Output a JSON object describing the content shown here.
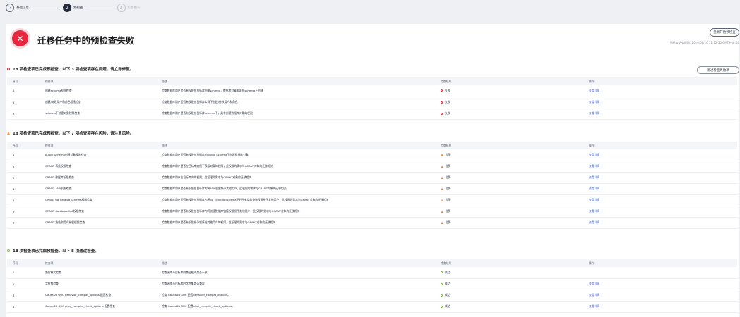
{
  "steps": [
    {
      "label": "基础信息",
      "state": "done"
    },
    {
      "number": "2",
      "label": "预检查",
      "state": "current"
    },
    {
      "number": "3",
      "label": "信息确认",
      "state": "pending"
    }
  ],
  "header": {
    "title": "迁移任务中的预检查失败",
    "recheck_label": "重新开始预检查",
    "check_time": "预检查结束时间: 2024/09/10 11:12:56 GMT+08:00"
  },
  "skip_label": "跳过检查失败项",
  "columns": [
    "序号",
    "检查项",
    "描述",
    "检查结果",
    "操作"
  ],
  "sections": [
    {
      "title": "18 项检查项已完成预检查。以下 3 项检查项存在问题，请立即修复。",
      "rows": [
        [
          "1",
          "创建schema权限检查",
          "检查数据库用户是否有权限在目标库创建schema，数据库对象需要在schema下创建",
          "失败",
          "查看详情"
        ],
        [
          "2",
          "创建/修改用户和角色权限检查",
          "检查数据库用户是否有权限在目标库实例下创建/修改用户和角色",
          "失败",
          "查看详情"
        ],
        [
          "3",
          "schema下创建对象权限检查",
          "检查数据库用户是否有权限在目标库schema下，具有创建数据库对象的权限。",
          "失败",
          "查看详情"
        ]
      ]
    },
    {
      "title": "18 项检查项已完成预检查。以下 7 项检查项存在风险，请注意风险。",
      "rows": [
        [
          "1",
          "public Schema创建对象权限检查",
          "检查数据库用户是否有权限在目标库的public Schema下创建数据库对象",
          "告警",
          "查看详情"
        ],
        [
          "2",
          "GRANT 表级权限检查",
          "检查数据库用户是否在目标库实例下表级对象的权限，此权限的需求与GRANT对象的迁移相关",
          "告警",
          "查看详情"
        ],
        [
          "3",
          "GRANT 数据库权限检查",
          "检查数据库用户在目标库内的权限，此权限的需求与GRANT对象的迁移相关",
          "告警",
          "查看详情"
        ],
        [
          "4",
          "GRANT ANY权限检查",
          "检查数据库用户是否有权限在目标库内将ANY权限授予其他用户，此权限的需求与GRANT对象的迁移相关",
          "告警",
          "查看详情"
        ],
        [
          "5",
          "GRANT pg_catalog Schema权限检查",
          "检查数据库用户是否有权限在目标库内将pg_catalog Schema下的所有类的查询权限授予其他用户，此权限的需求与GRANT对象的迁移相关",
          "告警",
          "查看详情"
        ],
        [
          "6",
          "GRANT database link权限检查",
          "检查数据库用户是否有权限在目标库内将创建数据库链接权限授予其他用户，此权限的需求与GRANT对象的迁移相关",
          "告警",
          "查看详情"
        ],
        [
          "7",
          "GRANT 角色和用户授权权限检查",
          "检查数据库用户是否有权限授予程序给其他用户的权限，此权限的需求与GRANT对象的迁移相关",
          "告警",
          "查看详情"
        ]
      ]
    },
    {
      "title": "18 项检查项已完成预检查。以下 8 项通过检查。",
      "rows": [
        [
          "1",
          "兼容模式检查",
          "检查源库与目标库的兼容模式是否一致",
          "成功",
          ""
        ],
        [
          "2",
          "字符集检查",
          "检查源库与目标库的字符集是否兼容",
          "成功",
          "查看详情"
        ],
        [
          "3",
          "GaussDB GUC behavior_compat_options 配置检查",
          "检查 GaussDB GUC 配置behavior_compat_options。",
          "成功",
          "查看详情"
        ],
        [
          "4",
          "GaussDB GUC plsql_compile_check_options 配置检查",
          "检查 GaussDB GUC 配置plsql_compile_check_options。",
          "成功",
          "查看详情"
        ]
      ]
    }
  ]
}
